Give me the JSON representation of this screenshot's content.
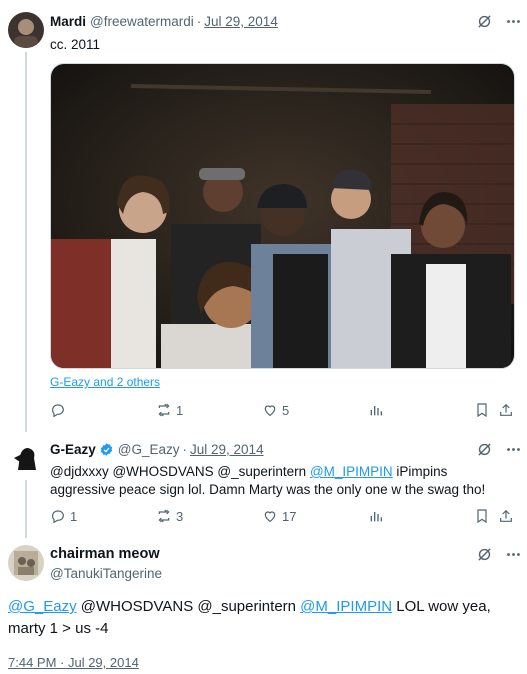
{
  "tweets": [
    {
      "name": "Mardi",
      "handle": "@freewatermardi",
      "sep": "·",
      "date": "Jul 29, 2014",
      "text": "cc. 2011",
      "tagged": "G-Eazy and 2 others",
      "stats": {
        "replies": "",
        "retweets": "1",
        "likes": "5"
      }
    },
    {
      "name": "G-Eazy",
      "handle": "@G_Eazy",
      "sep": "·",
      "date": "Jul 29, 2014",
      "text_parts": {
        "p1": "@djdxxxy @WHOSDVANS @_superintern ",
        "m1": "@M_IPIMPIN",
        "p2": " iPimpins aggressive peace sign lol. Damn Marty was the only one w the swag tho!"
      },
      "stats": {
        "replies": "1",
        "retweets": "3",
        "likes": "17"
      }
    }
  ],
  "main_tweet": {
    "name": "chairman meow",
    "handle": "@TanukiTangerine",
    "text_parts": {
      "m1": "@G_Eazy",
      "p1": " @WHOSDVANS @_superintern ",
      "m2": "@M_IPIMPIN",
      "p2": " LOL wow yea, marty 1 > us -4"
    },
    "timestamp": "7:44 PM · Jul 29, 2014"
  },
  "colors": {
    "accent": "#1d9bf0",
    "muted": "#536471",
    "line": "#cfd9de"
  },
  "icons": [
    "grok-icon",
    "more-icon",
    "reply-icon",
    "retweet-icon",
    "like-icon",
    "views-icon",
    "bookmark-icon",
    "share-icon",
    "verified-badge-icon"
  ]
}
